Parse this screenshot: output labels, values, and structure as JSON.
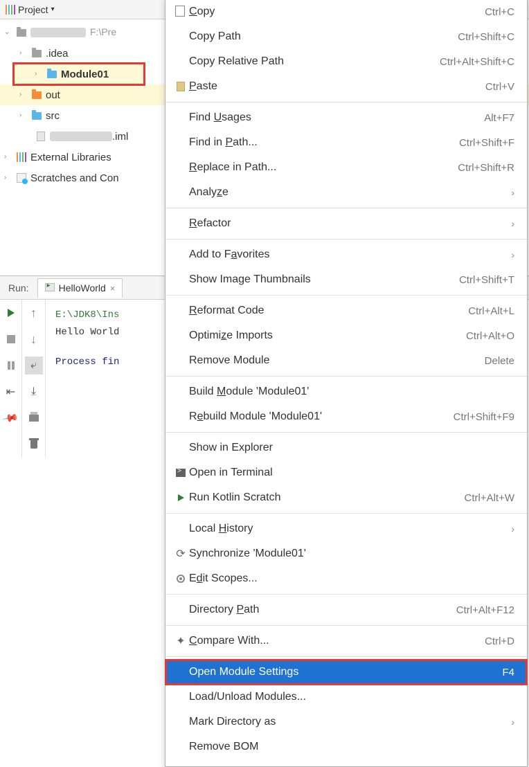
{
  "project": {
    "title": "Project",
    "root_path_hint": "F:\\Pre",
    "nodes": {
      "idea": ".idea",
      "module01": "Module01",
      "out": "out",
      "src": "src",
      "iml_suffix": ".iml",
      "external": "External Libraries",
      "scratches": "Scratches and Con"
    }
  },
  "run": {
    "label": "Run:",
    "tab": "HelloWorld",
    "lines": {
      "path": "E:\\JDK8\\Ins",
      "out": "Hello World",
      "exit": "Process fin"
    }
  },
  "menu": {
    "copy": {
      "label": "Copy",
      "u": "C",
      "short": "Ctrl+C"
    },
    "copy_path": {
      "label": "Copy Path",
      "short": "Ctrl+Shift+C"
    },
    "copy_rel": {
      "label": "Copy Relative Path",
      "short": "Ctrl+Alt+Shift+C"
    },
    "paste": {
      "label": "Paste",
      "u": "P",
      "short": "Ctrl+V"
    },
    "find_usages": {
      "label": "Find Usages",
      "u": "U",
      "short": "Alt+F7"
    },
    "find_in_path": {
      "label": "Find in Path...",
      "u": "P",
      "short": "Ctrl+Shift+F"
    },
    "replace_in_path": {
      "label": "Replace in Path...",
      "u": "R",
      "short": "Ctrl+Shift+R"
    },
    "analyze": {
      "label": "Analyze",
      "u": "z",
      "sub": true
    },
    "refactor": {
      "label": "Refactor",
      "u": "R",
      "sub": true
    },
    "fav": {
      "label": "Add to Favorites",
      "u": "a",
      "sub": true
    },
    "thumbs": {
      "label": "Show Image Thumbnails",
      "short": "Ctrl+Shift+T"
    },
    "reformat": {
      "label": "Reformat Code",
      "u": "R",
      "short": "Ctrl+Alt+L"
    },
    "optimize": {
      "label": "Optimize Imports",
      "u": "z",
      "short": "Ctrl+Alt+O"
    },
    "remove_module": {
      "label": "Remove Module",
      "short": "Delete"
    },
    "build": {
      "label": "Build Module 'Module01'",
      "u": "M"
    },
    "rebuild": {
      "label": "Rebuild Module 'Module01'",
      "u": "e",
      "short": "Ctrl+Shift+F9"
    },
    "show_explorer": {
      "label": "Show in Explorer"
    },
    "open_terminal": {
      "label": "Open in Terminal"
    },
    "run_kotlin": {
      "label": "Run Kotlin Scratch",
      "short": "Ctrl+Alt+W"
    },
    "local_history": {
      "label": "Local History",
      "u": "H",
      "sub": true
    },
    "sync": {
      "label": "Synchronize 'Module01'"
    },
    "edit_scopes": {
      "label": "Edit Scopes...",
      "u": "d"
    },
    "dir_path": {
      "label": "Directory Path",
      "u": "P",
      "short": "Ctrl+Alt+F12"
    },
    "compare": {
      "label": "Compare With...",
      "u": "C",
      "short": "Ctrl+D"
    },
    "open_module_settings": {
      "label": "Open Module Settings",
      "short": "F4"
    },
    "load_unload": {
      "label": "Load/Unload Modules..."
    },
    "mark_dir": {
      "label": "Mark Directory as",
      "sub": true
    },
    "remove_bom": {
      "label": "Remove BOM"
    }
  }
}
